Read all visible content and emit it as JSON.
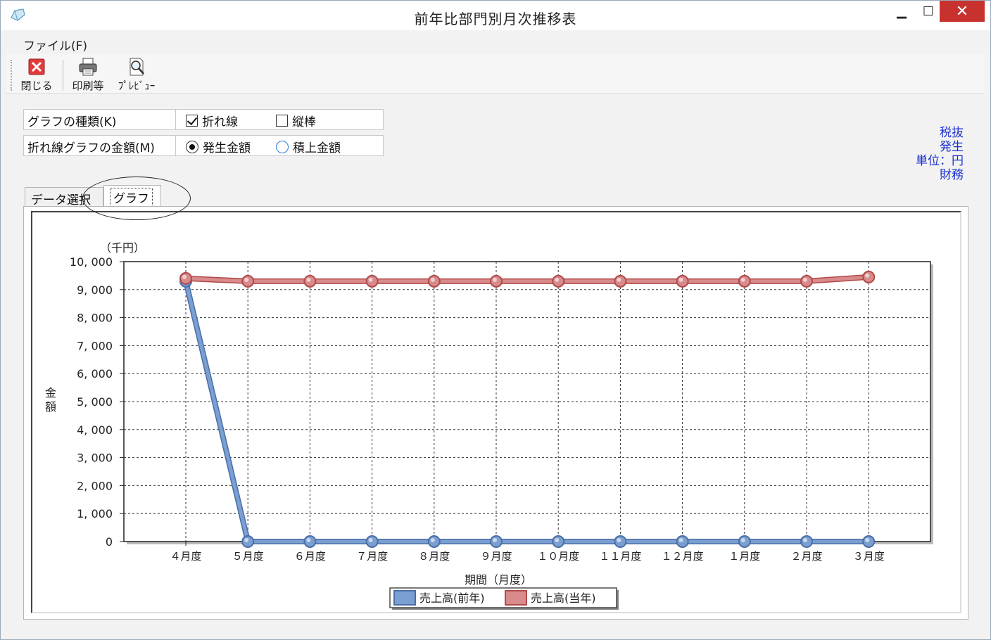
{
  "window": {
    "title": "前年比部門別月次推移表",
    "min_glyph": "▁",
    "max_glyph": "☐",
    "close_glyph": "✕"
  },
  "menu": {
    "file_label": "ファイル(F)"
  },
  "toolbar": {
    "close_label": "閉じる",
    "print_label": "印刷等",
    "preview_label": "ﾌﾟﾚﾋﾞｭｰ",
    "close_icon": "close-icon",
    "print_icon": "printer-icon",
    "preview_icon": "magnifier-icon"
  },
  "options": {
    "graph_type_label": "グラフの種類(K)",
    "line_label": "折れ線",
    "line_checked": true,
    "bar_label": "縦棒",
    "bar_checked": false,
    "amount_label": "折れ線グラフの金額(M)",
    "occurrence_label": "発生金額",
    "occurrence_selected": true,
    "cumulative_label": "積上金額",
    "cumulative_selected": false
  },
  "info": {
    "line1": "税抜",
    "line2": "発生",
    "line3": "単位：円",
    "line4": "財務"
  },
  "tabs": {
    "data_label": "データ選択",
    "graph_label": "グラフ",
    "active": "graph"
  },
  "colors": {
    "prev_year": "#7b9fd0",
    "prev_year_dark": "#4a6ea8",
    "curr_year": "#d98a8a",
    "curr_year_dark": "#b04a4a"
  },
  "chart_data": {
    "type": "line",
    "unit_label": "（千円）",
    "ylabel": "金額",
    "xlabel": "期間（月度）",
    "ylim": [
      0,
      10000
    ],
    "y_ticks": [
      0,
      1000,
      2000,
      3000,
      4000,
      5000,
      6000,
      7000,
      8000,
      9000,
      10000
    ],
    "y_tick_labels": [
      "0",
      "1, 000",
      "2, 000",
      "3, 000",
      "4, 000",
      "5, 000",
      "6, 000",
      "7, 000",
      "8, 000",
      "9, 000",
      "10, 000"
    ],
    "categories": [
      "４月度",
      "５月度",
      "６月度",
      "７月度",
      "８月度",
      "９月度",
      "１０月度",
      "１１月度",
      "１２月度",
      "１月度",
      "２月度",
      "３月度"
    ],
    "grid": true,
    "legend_position": "bottom",
    "series": [
      {
        "name": "売上高(前年)",
        "values": [
          9300,
          0,
          0,
          0,
          0,
          0,
          0,
          0,
          0,
          0,
          0,
          0
        ]
      },
      {
        "name": "売上高(当年)",
        "values": [
          9400,
          9300,
          9300,
          9300,
          9300,
          9300,
          9300,
          9300,
          9300,
          9300,
          9300,
          9450
        ]
      }
    ]
  }
}
